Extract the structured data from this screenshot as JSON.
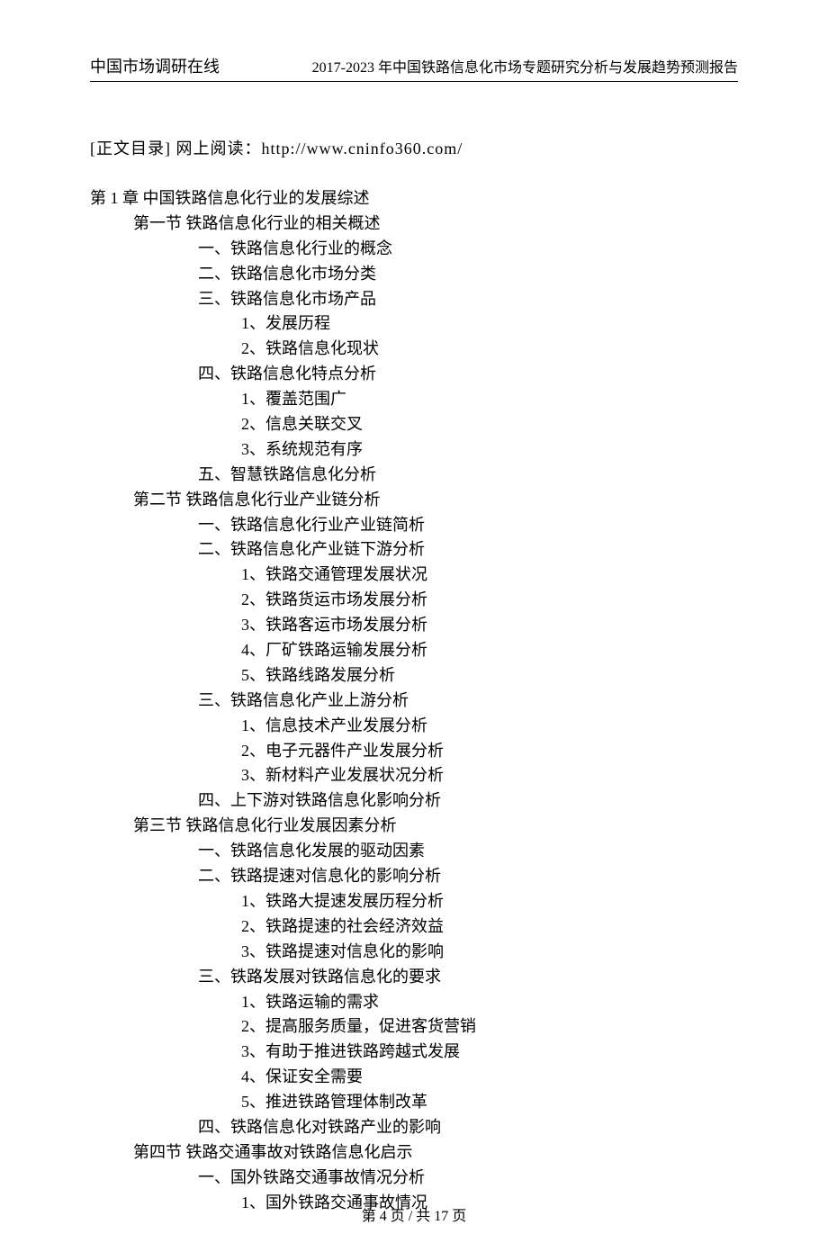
{
  "header": {
    "left": "中国市场调研在线",
    "right": "2017-2023 年中国铁路信息化市场专题研究分析与发展趋势预测报告"
  },
  "intro": "[正文目录] 网上阅读：http://www.cninfo360.com/",
  "toc": {
    "chapter": "第 1 章  中国铁路信息化行业的发展综述",
    "s1": {
      "title": "第一节 铁路信息化行业的相关概述",
      "i1": "一、铁路信息化行业的概念",
      "i2": "二、铁路信息化市场分类",
      "i3": "三、铁路信息化市场产品",
      "i3_1": "1、发展历程",
      "i3_2": "2、铁路信息化现状",
      "i4": "四、铁路信息化特点分析",
      "i4_1": "1、覆盖范围广",
      "i4_2": "2、信息关联交叉",
      "i4_3": "3、系统规范有序",
      "i5": "五、智慧铁路信息化分析"
    },
    "s2": {
      "title": "第二节 铁路信息化行业产业链分析",
      "i1": "一、铁路信息化行业产业链简析",
      "i2": "二、铁路信息化产业链下游分析",
      "i2_1": "1、铁路交通管理发展状况",
      "i2_2": "2、铁路货运市场发展分析",
      "i2_3": "3、铁路客运市场发展分析",
      "i2_4": "4、厂矿铁路运输发展分析",
      "i2_5": "5、铁路线路发展分析",
      "i3": "三、铁路信息化产业上游分析",
      "i3_1": "1、信息技术产业发展分析",
      "i3_2": "2、电子元器件产业发展分析",
      "i3_3": "3、新材料产业发展状况分析",
      "i4": "四、上下游对铁路信息化影响分析"
    },
    "s3": {
      "title": "第三节 铁路信息化行业发展因素分析",
      "i1": "一、铁路信息化发展的驱动因素",
      "i2": "二、铁路提速对信息化的影响分析",
      "i2_1": "1、铁路大提速发展历程分析",
      "i2_2": "2、铁路提速的社会经济效益",
      "i2_3": "3、铁路提速对信息化的影响",
      "i3": "三、铁路发展对铁路信息化的要求",
      "i3_1": "1、铁路运输的需求",
      "i3_2": "2、提高服务质量，促进客货营销",
      "i3_3": "3、有助于推进铁路跨越式发展",
      "i3_4": "4、保证安全需要",
      "i3_5": "5、推进铁路管理体制改革",
      "i4": "四、铁路信息化对铁路产业的影响"
    },
    "s4": {
      "title": "第四节 铁路交通事故对铁路信息化启示",
      "i1": "一、国外铁路交通事故情况分析",
      "i1_1": "1、国外铁路交通事故情况"
    }
  },
  "footer": "第 4 页 / 共 17 页"
}
